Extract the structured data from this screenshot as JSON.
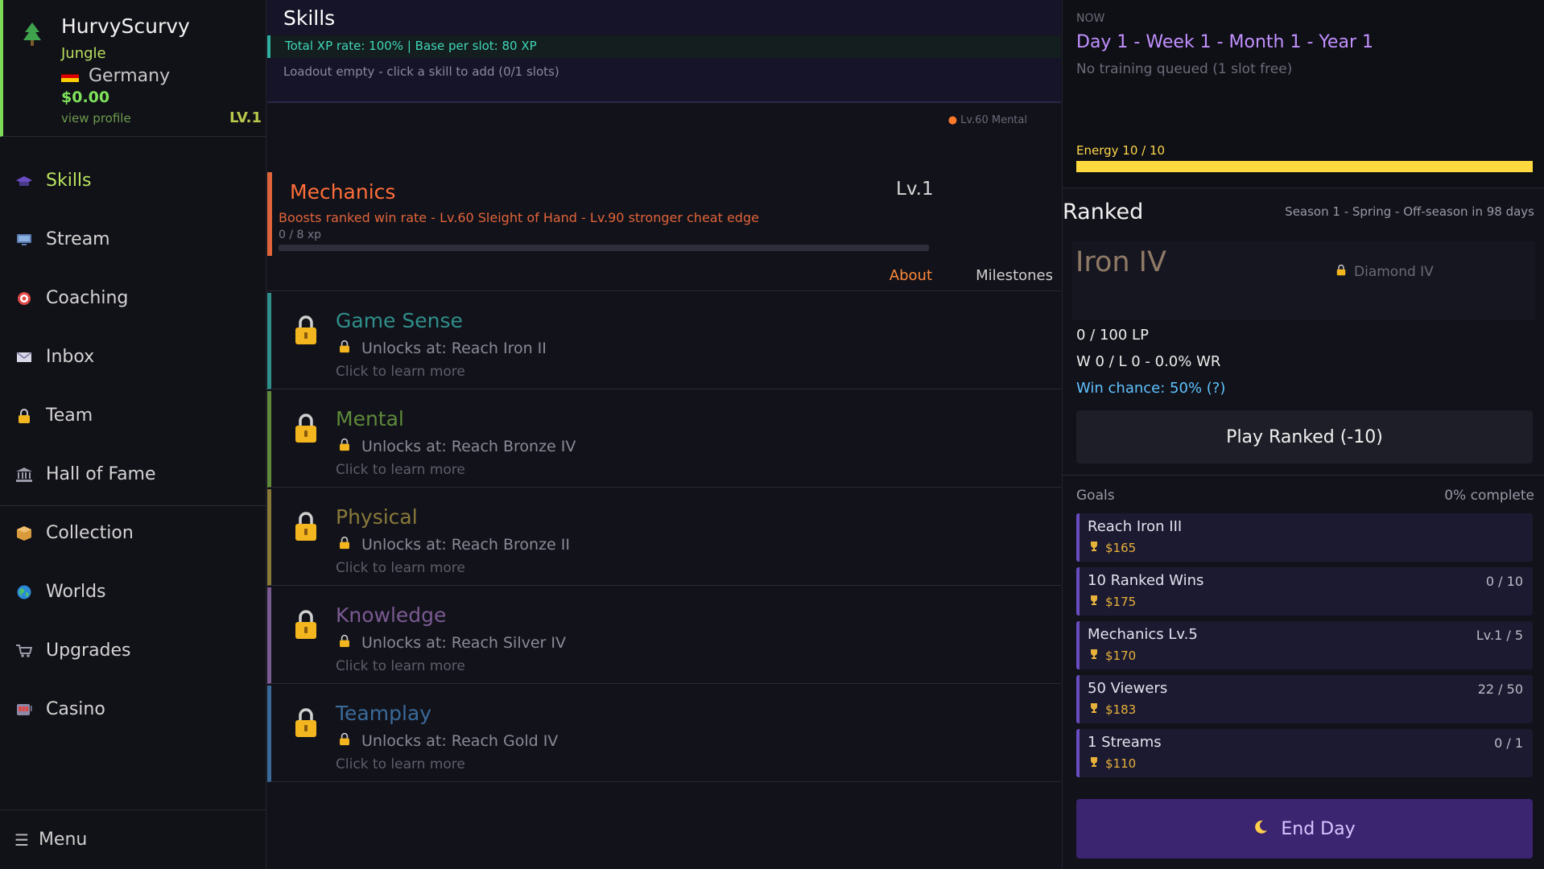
{
  "profile": {
    "name": "HurvyScurvy",
    "role": "Jungle",
    "country": "Germany",
    "money": "$0.00",
    "view_profile": "view profile",
    "level": "LV.1"
  },
  "nav": {
    "items": [
      {
        "label": "Skills",
        "icon": "graduation-cap-icon"
      },
      {
        "label": "Stream",
        "icon": "monitor-icon"
      },
      {
        "label": "Coaching",
        "icon": "target-icon"
      },
      {
        "label": "Inbox",
        "icon": "envelope-icon"
      },
      {
        "label": "Team",
        "icon": "lock-icon"
      },
      {
        "label": "Hall of Fame",
        "icon": "bank-icon"
      },
      {
        "label": "Collection",
        "icon": "box-icon"
      },
      {
        "label": "Worlds",
        "icon": "globe-icon"
      },
      {
        "label": "Upgrades",
        "icon": "cart-icon"
      },
      {
        "label": "Casino",
        "icon": "slot-machine-icon"
      }
    ],
    "menu_label": "Menu"
  },
  "skills_page": {
    "title": "Skills",
    "xp_line": "Total XP rate:  100%  |  Base per slot: 80 XP",
    "loadout": "Loadout empty - click a skill to add  (0/1 slots)",
    "mechanics_hint": "Lv.60 Mental",
    "mechanics": {
      "name": "Mechanics",
      "level": "Lv.1",
      "description": "Boosts ranked win rate  -  Lv.60 Sleight of Hand  -  Lv.90 stronger cheat edge",
      "xp": "0 / 8 xp",
      "progress": 0
    },
    "tabs": {
      "about": "About",
      "milestones": "Milestones"
    },
    "locked": [
      {
        "name": "Game Sense",
        "unlock": "Unlocks at: Reach Iron II",
        "learn": "Click to learn more",
        "color": "#2f8f8a"
      },
      {
        "name": "Mental",
        "unlock": "Unlocks at: Reach Bronze IV",
        "learn": "Click to learn more",
        "color": "#5e8a3a"
      },
      {
        "name": "Physical",
        "unlock": "Unlocks at: Reach Bronze II",
        "learn": "Click to learn more",
        "color": "#8a7a3a"
      },
      {
        "name": "Knowledge",
        "unlock": "Unlocks at: Reach Silver IV",
        "learn": "Click to learn more",
        "color": "#7a5a92"
      },
      {
        "name": "Teamplay",
        "unlock": "Unlocks at: Reach Gold IV",
        "learn": "Click to learn more",
        "color": "#3a6a9a"
      }
    ]
  },
  "status": {
    "now_label": "NOW",
    "date": "Day 1 - Week 1 - Month 1 - Year 1",
    "training": "No training queued  (1 slot free)",
    "energy_label": "Energy 10 / 10",
    "energy_fraction": 1.0
  },
  "ranked": {
    "title": "Ranked",
    "season": "Season 1 - Spring - Off-season in 98 days",
    "rank": "Iron IV",
    "target": "Diamond IV",
    "lp": "0 / 100 LP",
    "wl": "W 0  /  L 0  -  0.0% WR",
    "win_chance": "Win chance: 50%  (?)",
    "play_label": "Play Ranked (-10)"
  },
  "goals": {
    "label": "Goals",
    "complete": "0% complete",
    "items": [
      {
        "name": "Reach Iron III",
        "reward": "$165",
        "progress": ""
      },
      {
        "name": "10 Ranked Wins",
        "reward": "$175",
        "progress": "0 / 10"
      },
      {
        "name": "Mechanics Lv.5",
        "reward": "$170",
        "progress": "Lv.1 / 5"
      },
      {
        "name": "50 Viewers",
        "reward": "$183",
        "progress": "22 / 50"
      },
      {
        "name": "1 Streams",
        "reward": "$110",
        "progress": "0 / 1"
      }
    ]
  },
  "end_day_label": "End Day"
}
